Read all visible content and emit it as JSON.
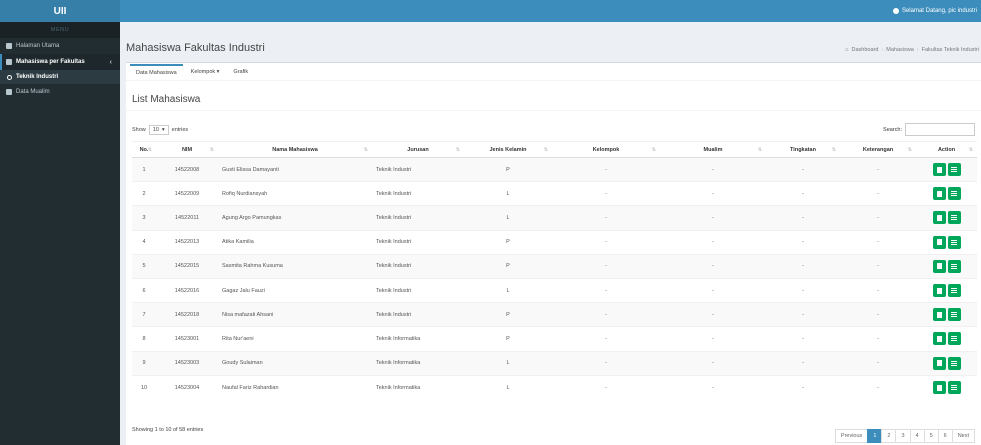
{
  "app": {
    "logo": "UII",
    "welcome": "Selamat Datang, pic industri"
  },
  "sidebar": {
    "header": "MENU",
    "items": [
      {
        "label": "Halaman Utama",
        "icon": "home-icon"
      },
      {
        "label": "Mahasiswa per Fakultas",
        "icon": "users-icon",
        "chevron": "‹"
      },
      {
        "label": "Teknik Industri",
        "icon": "circle-icon"
      },
      {
        "label": "Data Mualim",
        "icon": "group-icon"
      }
    ]
  },
  "page": {
    "title": "Mahasiswa Fakultas Industri",
    "breadcrumb": [
      "Dashboard",
      "Mahasiswa",
      "Fakultas Teknik Industri"
    ]
  },
  "tabs": [
    "Data Mahasiswa",
    "Kelompok ▾",
    "Grafik"
  ],
  "list": {
    "title": "List Mahasiswa",
    "show_label": "Show",
    "show_value": "10",
    "entries_label": "entries",
    "search_label": "Search:",
    "search_value": "",
    "columns": [
      "No.",
      "NIM",
      "Nama Mahasiswa",
      "Jurusan",
      "Jenis Kelamin",
      "Kelompok",
      "Mualim",
      "Tingkatan",
      "Keterangan",
      "Action"
    ],
    "rows": [
      [
        "1",
        "14522008",
        "Gusti Elissa Damayanti",
        "Teknik Industri",
        "P",
        "-",
        "-",
        "-",
        "-"
      ],
      [
        "2",
        "14522009",
        "Rofiq Nurdiansyah",
        "Teknik Industri",
        "L",
        "-",
        "-",
        "-",
        "-"
      ],
      [
        "3",
        "14522011",
        "Agung Argo Pamungkas",
        "Teknik Industri",
        "L",
        "-",
        "-",
        "-",
        "-"
      ],
      [
        "4",
        "14522013",
        "Atika Kamilia",
        "Teknik Industri",
        "P",
        "-",
        "-",
        "-",
        "-"
      ],
      [
        "5",
        "14522015",
        "Sasmita Rahma Kusuma",
        "Teknik Industri",
        "P",
        "-",
        "-",
        "-",
        "-"
      ],
      [
        "6",
        "14522016",
        "Gagaz Jalu Fauzi",
        "Teknik Industri",
        "L",
        "-",
        "-",
        "-",
        "-"
      ],
      [
        "7",
        "14522018",
        "Nisa mafazati Ahsani",
        "Teknik Industri",
        "P",
        "-",
        "-",
        "-",
        "-"
      ],
      [
        "8",
        "14523001",
        "Rita Nur'aeni",
        "Teknik Informatika",
        "P",
        "-",
        "-",
        "-",
        "-"
      ],
      [
        "9",
        "14523003",
        "Goudy Sulaiman",
        "Teknik Informatika",
        "L",
        "-",
        "-",
        "-",
        "-"
      ],
      [
        "10",
        "14523004",
        "Naufal Fariz Rahardian",
        "Teknik Informatika",
        "L",
        "-",
        "-",
        "-",
        "-"
      ]
    ],
    "info": "Showing 1 to 10 of 58 entries",
    "pager": [
      "Previous",
      "1",
      "2",
      "3",
      "4",
      "5",
      "6",
      "Next"
    ],
    "active_page": "1"
  },
  "colors": {
    "primary": "#3c8dbc",
    "sidebar": "#222d32",
    "action": "#00a65a"
  }
}
